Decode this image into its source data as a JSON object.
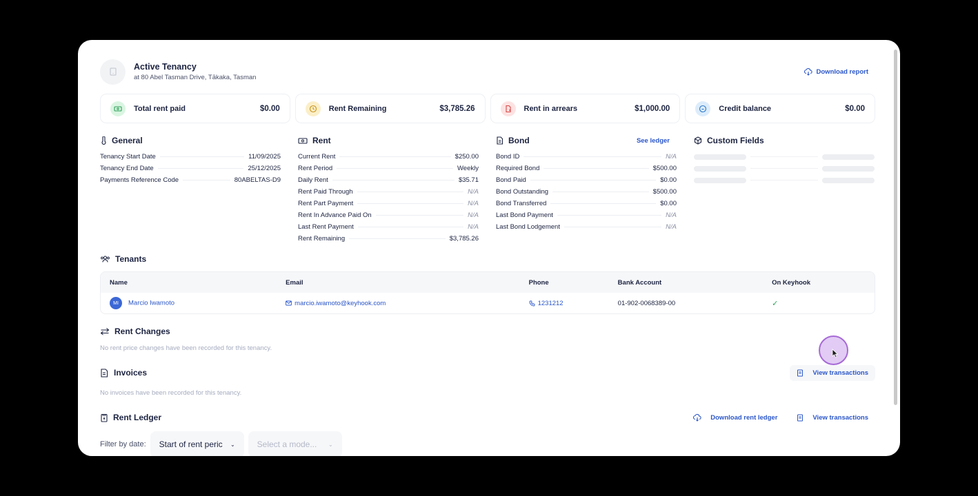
{
  "header": {
    "title": "Active Tenancy",
    "subtitle": "at 80 Abel Tasman Drive, Tākaka, Tasman",
    "download_report": "Download report"
  },
  "summary_cards": [
    {
      "label": "Total rent paid",
      "value": "$0.00",
      "icon": "money-icon",
      "color": "#d9f5e1"
    },
    {
      "label": "Rent Remaining",
      "value": "$3,785.26",
      "icon": "clock-icon",
      "color": "#fbefc8"
    },
    {
      "label": "Rent in arrears",
      "value": "$1,000.00",
      "icon": "document-alert-icon",
      "color": "#fde2e2"
    },
    {
      "label": "Credit balance",
      "value": "$0.00",
      "icon": "wallet-icon",
      "color": "#dcecfb"
    }
  ],
  "general": {
    "title": "General",
    "rows": [
      {
        "k": "Tenancy Start Date",
        "v": "11/09/2025"
      },
      {
        "k": "Tenancy End Date",
        "v": "25/12/2025"
      },
      {
        "k": "Payments Reference Code",
        "v": "80ABELTAS-D9"
      }
    ]
  },
  "rent": {
    "title": "Rent",
    "rows": [
      {
        "k": "Current Rent",
        "v": "$250.00"
      },
      {
        "k": "Rent Period",
        "v": "Weekly"
      },
      {
        "k": "Daily Rent",
        "v": "$35.71"
      },
      {
        "k": "Rent Paid Through",
        "v": "N/A"
      },
      {
        "k": "Rent Part Payment",
        "v": "N/A"
      },
      {
        "k": "Rent In Advance Paid On",
        "v": "N/A"
      },
      {
        "k": "Last Rent Payment",
        "v": "N/A"
      },
      {
        "k": "Rent Remaining",
        "v": "$3,785.26"
      }
    ]
  },
  "bond": {
    "title": "Bond",
    "link": "See ledger",
    "rows": [
      {
        "k": "Bond ID",
        "v": "N/A"
      },
      {
        "k": "Required Bond",
        "v": "$500.00"
      },
      {
        "k": "Bond Paid",
        "v": "$0.00"
      },
      {
        "k": "Bond Outstanding",
        "v": "$500.00"
      },
      {
        "k": "Bond Transferred",
        "v": "$0.00"
      },
      {
        "k": "Last Bond Payment",
        "v": "N/A"
      },
      {
        "k": "Last Bond Lodgement",
        "v": "N/A"
      }
    ]
  },
  "custom_fields": {
    "title": "Custom Fields"
  },
  "tenants": {
    "title": "Tenants",
    "columns": [
      "Name",
      "Email",
      "Phone",
      "Bank Account",
      "On Keyhook"
    ],
    "rows": [
      {
        "initials": "MI",
        "name": "Marcio Iwamoto",
        "email": "marcio.iwamoto@keyhook.com",
        "phone": "1231212",
        "bank": "01-902-0068389-00",
        "on_keyhook": "✓"
      }
    ]
  },
  "rent_changes": {
    "title": "Rent Changes",
    "empty": "No rent price changes have been recorded for this tenancy."
  },
  "invoices": {
    "title": "Invoices",
    "view_transactions": "View transactions",
    "empty": "No invoices have been recorded for this tenancy."
  },
  "rent_ledger": {
    "title": "Rent Ledger",
    "download": "Download rent ledger",
    "view_transactions": "View transactions",
    "filter_label": "Filter by date:",
    "filter_value": "Start of rent peric",
    "mode_placeholder": "Select a mode..."
  }
}
